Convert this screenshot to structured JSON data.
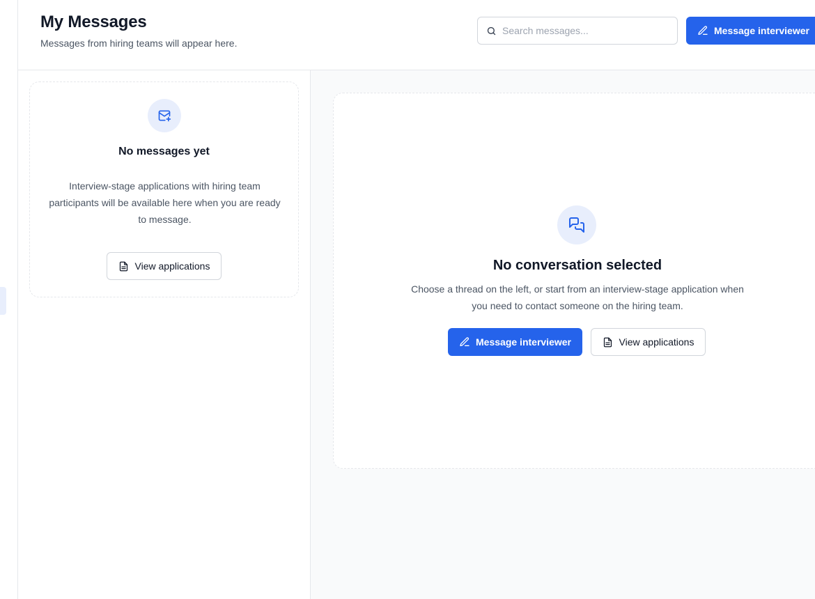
{
  "header": {
    "title": "My Messages",
    "subtitle": "Messages from hiring teams will appear here.",
    "search": {
      "placeholder": "Search messages...",
      "value": ""
    },
    "message_button_label": "Message interviewer"
  },
  "list_panel": {
    "empty_state": {
      "icon": "mail-plus-icon",
      "title": "No messages yet",
      "description": "Interview-stage applications with hiring team participants will be available here when you are ready to message.",
      "button_label": "View applications"
    }
  },
  "detail_panel": {
    "empty_state": {
      "icon": "chat-bubbles-icon",
      "title": "No conversation selected",
      "description": "Choose a thread on the left, or start from an interview-stage application when you need to contact someone on the hiring team.",
      "primary_button_label": "Message interviewer",
      "secondary_button_label": "View applications"
    }
  },
  "colors": {
    "accent": "#2563eb",
    "icon_bg": "#e8eefc",
    "border": "#e5e7eb",
    "muted_text": "#4b5563",
    "panel_bg": "#f9fafb"
  }
}
